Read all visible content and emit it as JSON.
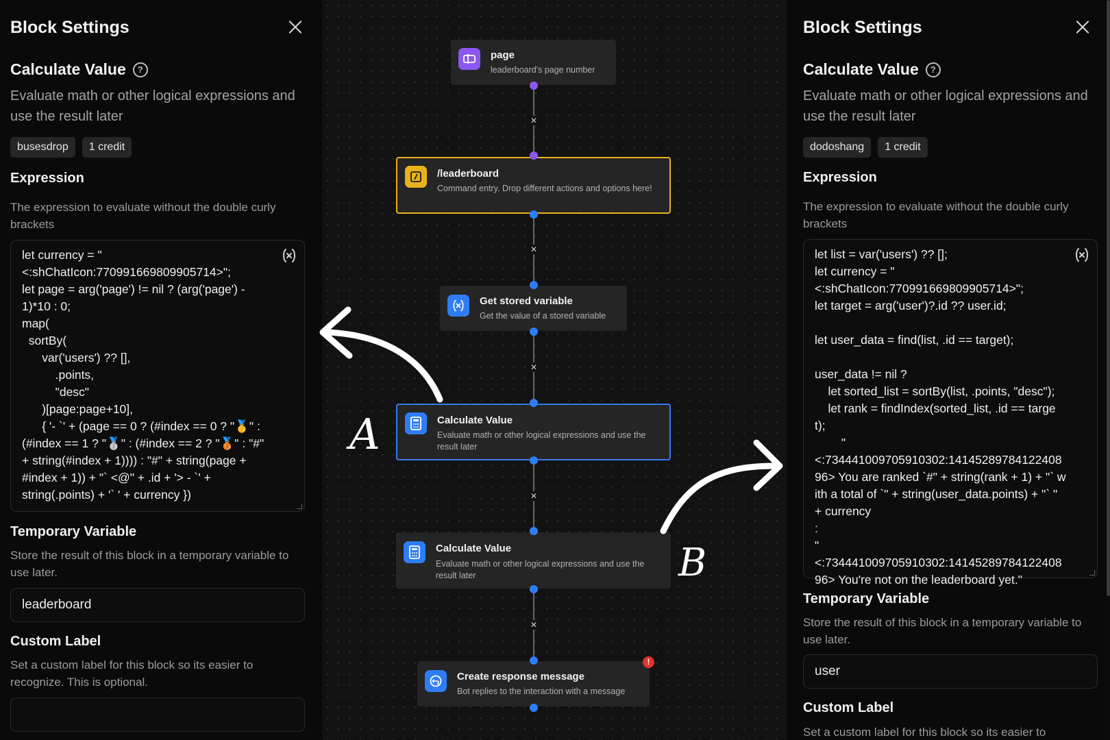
{
  "left_panel": {
    "title": "Block Settings",
    "block_title": "Calculate Value",
    "block_description": "Evaluate math or other logical expressions and use the result later",
    "tags": [
      "busesdrop",
      "1 credit"
    ],
    "expression": {
      "title": "Expression",
      "description": "The expression to evaluate without the double curly brackets",
      "code": "let currency = \"\n<:shChatIcon:770991669809905714>\";\nlet page = arg('page') != nil ? (arg('page') -\n1)*10 : 0;\nmap(\n  sortBy(\n      var('users') ?? [],\n          .points,\n          \"desc\"\n      )[page:page+10],\n      { '- `' + (page == 0 ? (#index == 0 ? \"🥇\" :\n(#index == 1 ? \"🥈\" : (#index == 2 ? \"🥉\" : \"#\"\n+ string(#index + 1)))) : \"#\" + string(page +\n#index + 1)) + \"` <@\" + .id + '> - `' +\nstring(.points) + '` ' + currency })"
    },
    "temp_var": {
      "title": "Temporary Variable",
      "description": "Store the result of this block in a temporary variable to use later.",
      "value": "leaderboard"
    },
    "custom_label": {
      "title": "Custom Label",
      "description": "Set a custom label for this block so its easier to recognize. This is optional.",
      "value": ""
    }
  },
  "right_panel": {
    "title": "Block Settings",
    "block_title": "Calculate Value",
    "block_description": "Evaluate math or other logical expressions and use the result later",
    "tags": [
      "dodoshang",
      "1 credit"
    ],
    "expression": {
      "title": "Expression",
      "description": "The expression to evaluate without the double curly brackets",
      "code": "let list = var('users') ?? [];\nlet currency = \"\n<:shChatIcon:770991669809905714>\";\nlet target = arg('user')?.id ?? user.id;\n\nlet user_data = find(list, .id == target);\n\nuser_data != nil ?\n    let sorted_list = sortBy(list, .points, \"desc\");\n    let rank = findIndex(sorted_list, .id == target);\n        \"\n<:734441009705910302:1414528978412240896> You are ranked `#\" + string(rank + 1) + \"` with a total of `\" + string(user_data.points) + \"` \" + currency\n:\n\"\n<:734441009705910302:1414528978412240896> You're not on the leaderboard yet.\""
    },
    "temp_var": {
      "title": "Temporary Variable",
      "description": "Store the result of this block in a temporary variable to use later.",
      "value": "user"
    },
    "custom_label": {
      "title": "Custom Label",
      "description": "Set a custom label for this block so its easier to"
    }
  },
  "canvas": {
    "nodes": [
      {
        "title": "page",
        "description": "leaderboard's page number",
        "icon": "option-icon",
        "color": "#8b57ee"
      },
      {
        "title": "/leaderboard",
        "description": "Command entry. Drop different actions and options here!",
        "icon": "command-icon",
        "color": "#eab21a"
      },
      {
        "title": "Get stored variable",
        "description": "Get the value of a stored variable",
        "icon": "variable-icon",
        "color": "#2f7df6"
      },
      {
        "title": "Calculate Value",
        "description": "Evaluate math or other logical expressions and use the result later",
        "icon": "calculator-icon",
        "color": "#2f7df6"
      },
      {
        "title": "Calculate Value",
        "description": "Evaluate math or other logical expressions and use the result later",
        "icon": "calculator-icon",
        "color": "#2f7df6"
      },
      {
        "title": "Create response message",
        "description": "Bot replies to the interaction with a message",
        "icon": "reply-icon",
        "color": "#2f7df6",
        "alert": "!"
      }
    ]
  },
  "annotations": {
    "a_label": "A",
    "b_label": "B"
  }
}
